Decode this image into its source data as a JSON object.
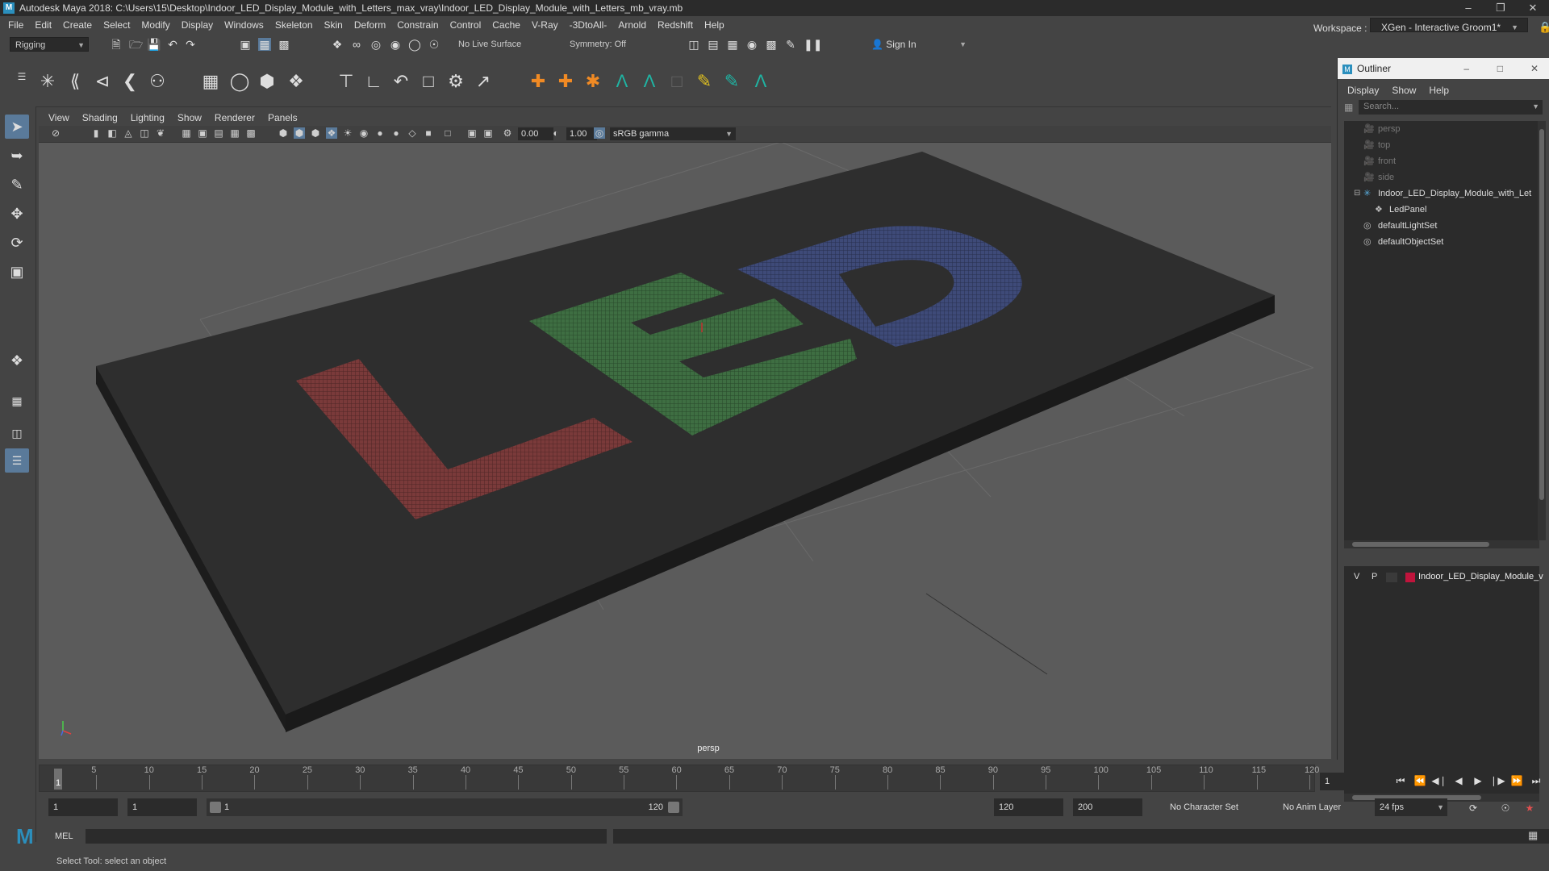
{
  "titlebar": {
    "title": "Autodesk Maya 2018: C:\\Users\\15\\Desktop\\Indoor_LED_Display_Module_with_Letters_max_vray\\Indoor_LED_Display_Module_with_Letters_mb_vray.mb"
  },
  "menubar": {
    "items": [
      "File",
      "Edit",
      "Create",
      "Select",
      "Modify",
      "Display",
      "Windows",
      "Skeleton",
      "Skin",
      "Deform",
      "Constrain",
      "Control",
      "Cache",
      "V-Ray",
      "-3DtoAll-",
      "Arnold",
      "Redshift",
      "Help"
    ],
    "workspace_label": "Workspace :",
    "workspace_value": "XGen - Interactive Groom1*"
  },
  "statusline": {
    "mode": "Rigging",
    "live_surface": "No Live Surface",
    "symmetry": "Symmetry: Off",
    "sign_in": "Sign In"
  },
  "viewport": {
    "menu": [
      "View",
      "Shading",
      "Lighting",
      "Show",
      "Renderer",
      "Panels"
    ],
    "exposure": "0.00",
    "gamma": "1.00",
    "color_space": "sRGB gamma",
    "camera_label": "persp",
    "letters": [
      "L",
      "E",
      "D"
    ],
    "colors": {
      "L": "#7a3a3a",
      "E": "#3e6e42",
      "D": "#3e4a78"
    }
  },
  "outliner": {
    "title": "Outliner",
    "menu": [
      "Display",
      "Show",
      "Help"
    ],
    "search_placeholder": "Search...",
    "items": [
      {
        "label": "persp",
        "dim": true
      },
      {
        "label": "top",
        "dim": true
      },
      {
        "label": "front",
        "dim": true
      },
      {
        "label": "side",
        "dim": true
      },
      {
        "label": "Indoor_LED_Display_Module_with_Let",
        "dim": false
      },
      {
        "label": "LedPanel",
        "dim": false
      },
      {
        "label": "defaultLightSet",
        "dim": false
      },
      {
        "label": "defaultObjectSet",
        "dim": false
      }
    ],
    "layer": {
      "v": "V",
      "p": "P",
      "name": "Indoor_LED_Display_Module_v",
      "color": "#c0143c"
    }
  },
  "timeline": {
    "ticks": [
      "5",
      "10",
      "15",
      "20",
      "25",
      "30",
      "35",
      "40",
      "45",
      "50",
      "55",
      "60",
      "65",
      "70",
      "75",
      "80",
      "85",
      "90",
      "95",
      "100",
      "105",
      "110",
      "115",
      "120"
    ],
    "current_frame_marker": "1",
    "current_frame": "1"
  },
  "range": {
    "start": "1",
    "anim_start": "1",
    "slider_start": "1",
    "slider_end": "120",
    "anim_end": "120",
    "end": "200",
    "character_set": "No Character Set",
    "anim_layer": "No Anim Layer",
    "fps": "24 fps"
  },
  "cmdline": {
    "language": "MEL"
  },
  "helpline": {
    "text": "Select Tool: select an object"
  }
}
